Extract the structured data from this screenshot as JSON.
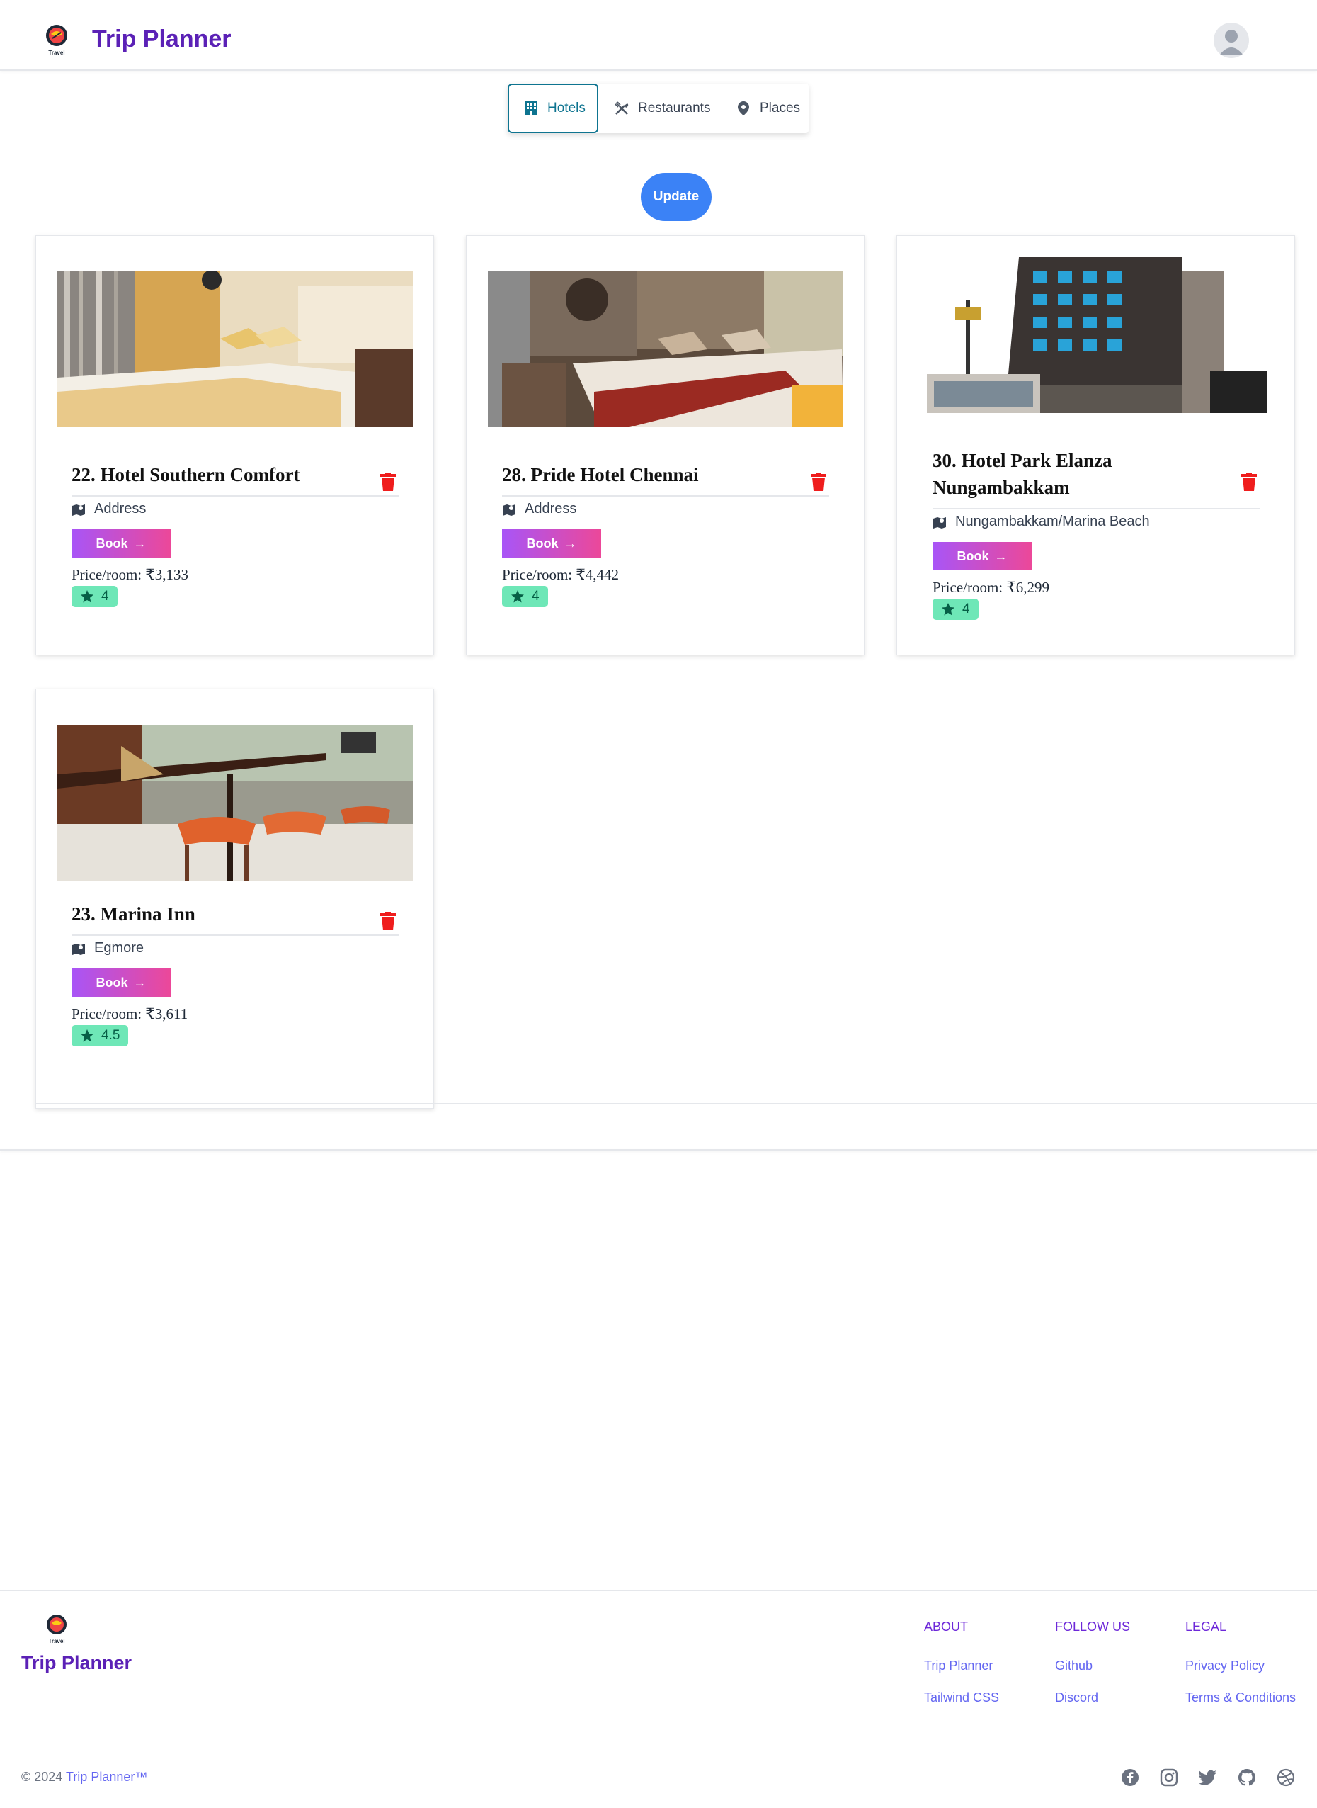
{
  "header": {
    "brand": "Trip Planner",
    "logo_text": "Travel"
  },
  "tabs": [
    {
      "label": "Hotels",
      "icon": "building-icon",
      "active": true
    },
    {
      "label": "Restaurants",
      "icon": "utensils-icon",
      "active": false
    },
    {
      "label": "Places",
      "icon": "map-pin-icon",
      "active": false
    }
  ],
  "update_label": "Update",
  "book_label": "Book",
  "price_prefix": "Price/room: ",
  "cards": [
    {
      "title": "22. Hotel Southern Comfort",
      "address": "Address",
      "price": "₹3,133",
      "rating": "4"
    },
    {
      "title": "28. Pride Hotel Chennai",
      "address": "Address",
      "price": "₹4,442",
      "rating": "4"
    },
    {
      "title": "30. Hotel Park Elanza Nungambakkam",
      "address": "Nungambakkam/Marina Beach",
      "price": "₹6,299",
      "rating": "4"
    },
    {
      "title": "23. Marina Inn",
      "address": "Egmore",
      "price": "₹3,611",
      "rating": "4.5"
    }
  ],
  "footer": {
    "brand": "Trip Planner",
    "logo_text": "Travel",
    "columns": [
      {
        "heading": "About",
        "links": [
          "Trip Planner",
          "Tailwind CSS"
        ]
      },
      {
        "heading": "Follow us",
        "links": [
          "Github",
          "Discord"
        ]
      },
      {
        "heading": "Legal",
        "links": [
          "Privacy Policy",
          "Terms & Conditions"
        ]
      }
    ],
    "copyright_prefix": "© 2024 ",
    "copyright_brand": "Trip Planner™",
    "social": [
      "facebook-icon",
      "instagram-icon",
      "twitter-icon",
      "github-icon",
      "dribbble-icon"
    ]
  },
  "colors": {
    "brand": "#5b21b6",
    "accent": "#3b82f6",
    "book_from": "#a855f7",
    "book_to": "#ec4899",
    "rating_bg": "#6ee7b7",
    "trash": "#ef1d1d"
  }
}
